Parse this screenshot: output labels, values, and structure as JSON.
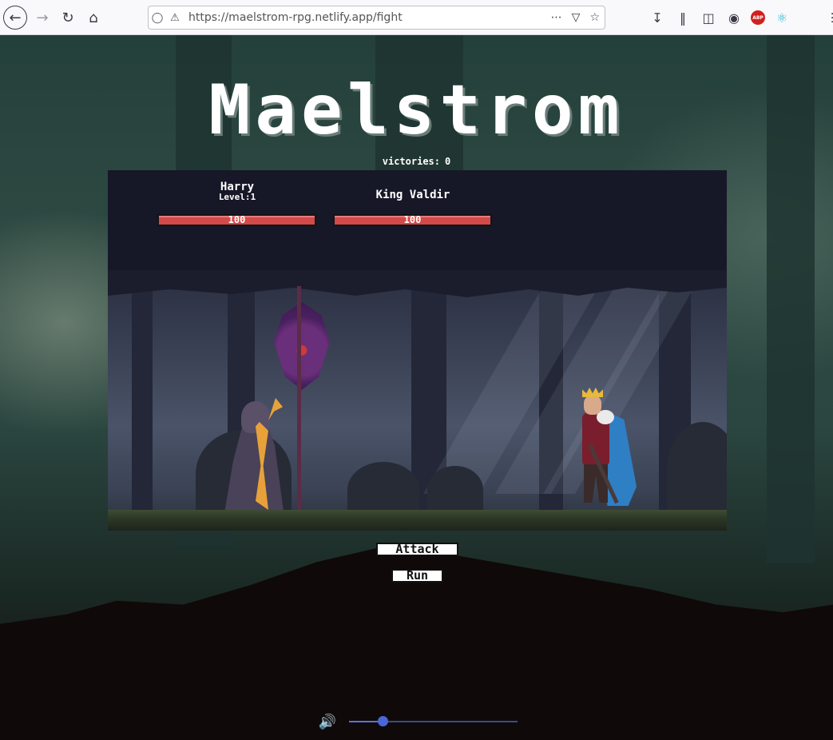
{
  "browser": {
    "url": "https://maelstrom-rpg.netlify.app/fight",
    "url_host": "maelstrom-rpg.netlify.app",
    "url_path": "/fight",
    "abp_label": "ABP",
    "icons": {
      "back": "back-arrow-icon",
      "forward": "forward-arrow-icon",
      "reload": "reload-icon",
      "home": "home-icon",
      "shield": "tracking-shield-icon",
      "lock": "lock-warning-icon",
      "more": "ellipsis-icon",
      "pocket": "pocket-icon",
      "bookmark": "star-icon",
      "download": "download-icon",
      "library": "library-icon",
      "sidebar": "sidebar-icon",
      "account": "account-icon",
      "adblock": "adblock-plus-icon",
      "react": "react-devtools-icon",
      "menu": "hamburger-menu-icon"
    }
  },
  "game": {
    "title": "Maelstrom",
    "victories_label": "victories:",
    "victories_value": "0"
  },
  "hero": {
    "name": "Harry",
    "level_label": "Level:",
    "level": "1",
    "hp": "100",
    "hp_fraction": 1.0
  },
  "enemy": {
    "name": "King Valdir",
    "hp": "100",
    "hp_fraction": 1.0
  },
  "actions": {
    "attack_label": "Attack",
    "run_label": "Run"
  },
  "audio": {
    "volume_icon": "speaker-icon",
    "volume_fraction": 0.2
  },
  "colors": {
    "hp_bar": "#d34a4a",
    "panel_bg": "#161828",
    "volume_accent": "#4a66d8"
  }
}
